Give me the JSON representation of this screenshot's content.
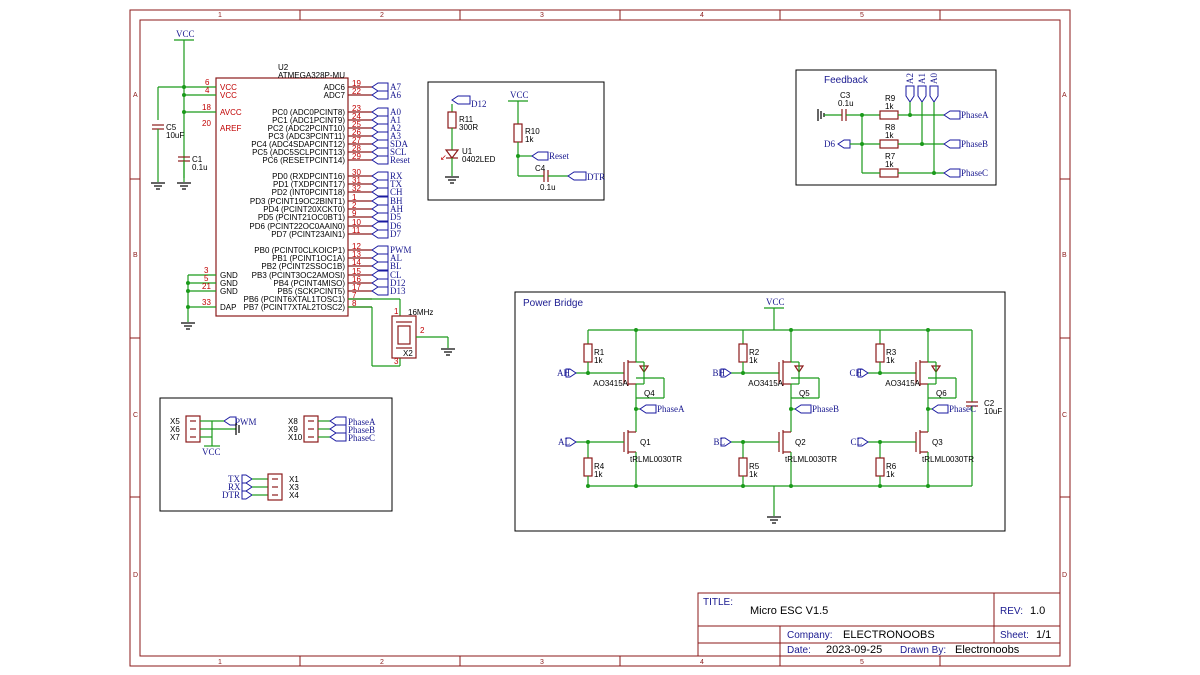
{
  "frame": {
    "columns": [
      "1",
      "2",
      "3",
      "4",
      "5"
    ],
    "rows": [
      "A",
      "B",
      "C",
      "D"
    ]
  },
  "title_block": {
    "title_label": "TITLE:",
    "title": "Micro ESC V1.5",
    "rev_label": "REV:",
    "rev": "1.0",
    "company_label": "Company:",
    "company": "ELECTRONOOBS",
    "sheet_label": "Sheet:",
    "sheet": "1/1",
    "date_label": "Date:",
    "date": "2023-09-25",
    "drawn_label": "Drawn By:",
    "drawn": "Electronoobs"
  },
  "mcu": {
    "ref": "U2",
    "part": "ATMEGA328P-MU",
    "vcc_net": "VCC",
    "power_pins": [
      {
        "num": "6",
        "name": "VCC"
      },
      {
        "num": "4",
        "name": "VCC"
      },
      {
        "num": "18",
        "name": "AVCC"
      },
      {
        "num": "20",
        "name": "AREF"
      }
    ],
    "gnd_pins": [
      {
        "num": "3",
        "name": "GND"
      },
      {
        "num": "5",
        "name": "GND"
      },
      {
        "num": "21",
        "name": "GND"
      },
      {
        "num": "33",
        "name": "DAP"
      }
    ],
    "right_pins": [
      {
        "name": "ADC6",
        "num": "19",
        "net": "A7"
      },
      {
        "name": "ADC7",
        "num": "22",
        "net": "A6"
      },
      {
        "name": "PC0 (ADC0PCINT8)",
        "num": "23",
        "net": "A0"
      },
      {
        "name": "PC1 (ADC1PCINT9)",
        "num": "24",
        "net": "A1"
      },
      {
        "name": "PC2 (ADC2PCINT10)",
        "num": "25",
        "net": "A2"
      },
      {
        "name": "PC3 (ADC3PCINT11)",
        "num": "26",
        "net": "A3"
      },
      {
        "name": "PC4 (ADC4SDAPCINT12)",
        "num": "27",
        "net": "SDA"
      },
      {
        "name": "PC5 (ADC5SCLPCINT13)",
        "num": "28",
        "net": "SCL"
      },
      {
        "name": "PC6 (RESETPCINT14)",
        "num": "29",
        "net": "Reset"
      },
      {
        "name": "PD0 (RXDPCINT16)",
        "num": "30",
        "net": "RX"
      },
      {
        "name": "PD1 (TXDPCINT17)",
        "num": "31",
        "net": "TX"
      },
      {
        "name": "PD2 (INT0PCINT18)",
        "num": "32",
        "net": "CH"
      },
      {
        "name": "PD3 (PCINT19OC2BINT1)",
        "num": "1",
        "net": "BH"
      },
      {
        "name": "PD4 (PCINT20XCKT0)",
        "num": "2",
        "net": "AH"
      },
      {
        "name": "PD5 (PCINT21OC0BT1)",
        "num": "9",
        "net": "D5"
      },
      {
        "name": "PD6 (PCINT22OC0AAIN0)",
        "num": "10",
        "net": "D6"
      },
      {
        "name": "PD7 (PCINT23AIN1)",
        "num": "11",
        "net": "D7"
      },
      {
        "name": "PB0 (PCINT0CLKOICP1)",
        "num": "12",
        "net": "PWM"
      },
      {
        "name": "PB1 (PCINT1OC1A)",
        "num": "13",
        "net": "AL"
      },
      {
        "name": "PB2 (PCINT2SSOC1B)",
        "num": "14",
        "net": "BL"
      },
      {
        "name": "PB3 (PCINT3OC2AMOSI)",
        "num": "15",
        "net": "CL"
      },
      {
        "name": "PB4 (PCINT4MISO)",
        "num": "16",
        "net": "D12"
      },
      {
        "name": "PB5 (SCKPCINT5)",
        "num": "17",
        "net": "D13"
      },
      {
        "name": "PB6 (PCINT6XTAL1TOSC1)",
        "num": "7",
        "net": ""
      },
      {
        "name": "PB7 (PCINT7XTAL2TOSC2)",
        "num": "8",
        "net": ""
      }
    ],
    "c5": {
      "ref": "C5",
      "value": "10uF"
    },
    "c1": {
      "ref": "C1",
      "value": "0.1u"
    },
    "crystal": {
      "ref": "X2",
      "value": "16MHz",
      "pin1": "1",
      "pin2": "2",
      "pin3": "3"
    }
  },
  "led_block": {
    "net_d12": "D12",
    "r11": {
      "ref": "R11",
      "value": "300R"
    },
    "u1": {
      "ref": "U1",
      "value": "0402LED"
    },
    "vcc": "VCC",
    "r10": {
      "ref": "R10",
      "value": "1k"
    },
    "reset": "Reset",
    "c4": {
      "ref": "C4",
      "value": "0.1u"
    },
    "dtr": "DTR"
  },
  "feedback": {
    "title": "Feedback",
    "top_nets": [
      "A2",
      "A1",
      "A0"
    ],
    "c3": {
      "ref": "C3",
      "value": "0.1u"
    },
    "r9": {
      "ref": "R9",
      "value": "1k"
    },
    "r8": {
      "ref": "R8",
      "value": "1k"
    },
    "r7": {
      "ref": "R7",
      "value": "1k"
    },
    "d6": "D6",
    "phases": [
      "PhaseA",
      "PhaseB",
      "PhaseC"
    ]
  },
  "power_bridge": {
    "title": "Power Bridge",
    "vcc": "VCC",
    "legs": [
      {
        "hi_net": "AH",
        "lo_net": "AL",
        "rh": {
          "ref": "R1",
          "value": "1k"
        },
        "rl": {
          "ref": "R4",
          "value": "1k"
        },
        "pfet": {
          "ref": "Q4",
          "value": "AO3415A"
        },
        "nfet": {
          "ref": "Q1",
          "value": "tRLML0030TR"
        },
        "phase": "PhaseA"
      },
      {
        "hi_net": "BH",
        "lo_net": "BL",
        "rh": {
          "ref": "R2",
          "value": "1k"
        },
        "rl": {
          "ref": "R5",
          "value": "1k"
        },
        "pfet": {
          "ref": "Q5",
          "value": "AO3415A"
        },
        "nfet": {
          "ref": "Q2",
          "value": "tRLML0030TR"
        },
        "phase": "PhaseB"
      },
      {
        "hi_net": "CH",
        "lo_net": "CL",
        "rh": {
          "ref": "R3",
          "value": "1k"
        },
        "rl": {
          "ref": "R6",
          "value": "1k"
        },
        "pfet": {
          "ref": "Q6",
          "value": "AO3415A"
        },
        "nfet": {
          "ref": "Q3",
          "value": "tRLML0030TR"
        },
        "phase": "PhaseC"
      }
    ],
    "c2": {
      "ref": "C2",
      "value": "10uF"
    }
  },
  "connectors": {
    "x_pwm": {
      "refs": [
        "X5",
        "X6",
        "X7"
      ],
      "net": "PWM",
      "vcc": "VCC"
    },
    "x_phase": {
      "refs": [
        "X8",
        "X9",
        "X10"
      ],
      "nets": [
        "PhaseA",
        "PhaseB",
        "PhaseC"
      ]
    },
    "x_serial": {
      "refs": [
        "X1",
        "X3",
        "X4"
      ],
      "nets": [
        "TX",
        "RX",
        "DTR"
      ]
    }
  }
}
